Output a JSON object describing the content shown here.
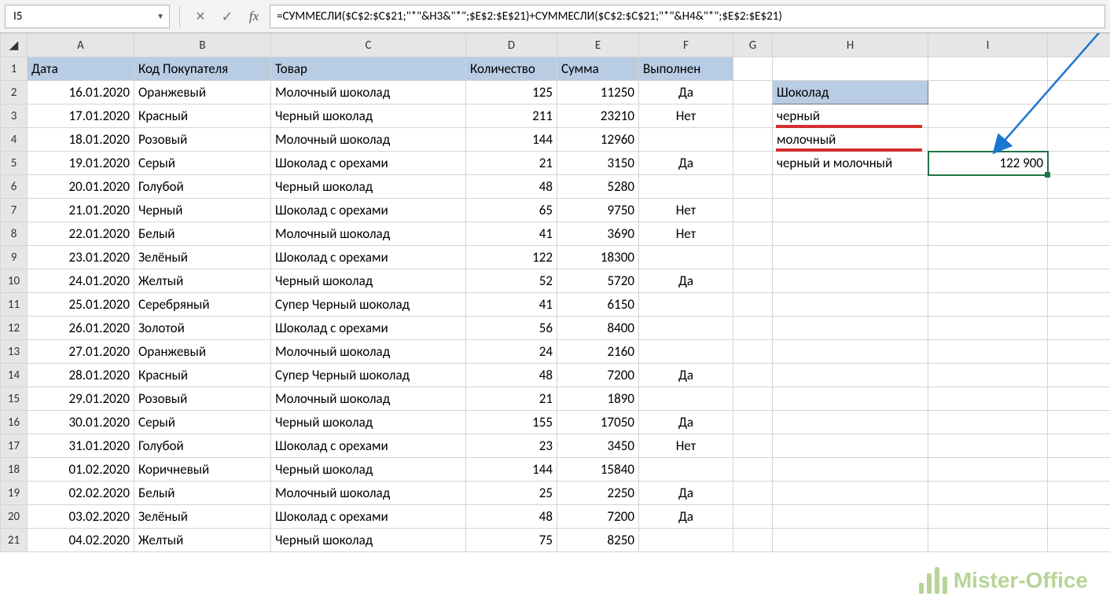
{
  "name_box": "I5",
  "formula": "=СУММЕСЛИ($C$2:$C$21;\"*\"&H3&\"*\";$E$2:$E$21)+СУММЕСЛИ($C$2:$C$21;\"*\"&H4&\"*\";$E$2:$E$21)",
  "fx_label": "fx",
  "columns": [
    "A",
    "B",
    "C",
    "D",
    "E",
    "F",
    "G",
    "H",
    "I"
  ],
  "headers": {
    "A": "Дата",
    "B": "Код Покупателя",
    "C": "Товар",
    "D": "Количество",
    "E": "Сумма",
    "F": "Выполнен"
  },
  "side": {
    "H2": "Шоколад",
    "H3": "черный",
    "H4": "молочный",
    "H5": "черный и молочный",
    "I5": "122 900"
  },
  "rows": [
    {
      "n": 1
    },
    {
      "n": 2,
      "A": "16.01.2020",
      "B": "Оранжевый",
      "C": "Молочный шоколад",
      "D": "125",
      "E": "11250",
      "F": "Да"
    },
    {
      "n": 3,
      "A": "17.01.2020",
      "B": "Красный",
      "C": "Черный шоколад",
      "D": "211",
      "E": "23210",
      "F": "Нет"
    },
    {
      "n": 4,
      "A": "18.01.2020",
      "B": "Розовый",
      "C": "Молочный шоколад",
      "D": "144",
      "E": "12960",
      "F": ""
    },
    {
      "n": 5,
      "A": "19.01.2020",
      "B": "Серый",
      "C": "Шоколад с орехами",
      "D": "21",
      "E": "3150",
      "F": "Да"
    },
    {
      "n": 6,
      "A": "20.01.2020",
      "B": "Голубой",
      "C": "Черный шоколад",
      "D": "48",
      "E": "5280",
      "F": ""
    },
    {
      "n": 7,
      "A": "21.01.2020",
      "B": "Черный",
      "C": "Шоколад с орехами",
      "D": "65",
      "E": "9750",
      "F": "Нет"
    },
    {
      "n": 8,
      "A": "22.01.2020",
      "B": "Белый",
      "C": "Молочный шоколад",
      "D": "41",
      "E": "3690",
      "F": "Нет"
    },
    {
      "n": 9,
      "A": "23.01.2020",
      "B": "Зелёный",
      "C": "Шоколад с орехами",
      "D": "122",
      "E": "18300",
      "F": ""
    },
    {
      "n": 10,
      "A": "24.01.2020",
      "B": "Желтый",
      "C": "Черный шоколад",
      "D": "52",
      "E": "5720",
      "F": "Да"
    },
    {
      "n": 11,
      "A": "25.01.2020",
      "B": "Серебряный",
      "C": "Супер Черный шоколад",
      "D": "41",
      "E": "6150",
      "F": ""
    },
    {
      "n": 12,
      "A": "26.01.2020",
      "B": "Золотой",
      "C": "Шоколад с орехами",
      "D": "56",
      "E": "8400",
      "F": ""
    },
    {
      "n": 13,
      "A": "27.01.2020",
      "B": "Оранжевый",
      "C": "Молочный шоколад",
      "D": "24",
      "E": "2160",
      "F": ""
    },
    {
      "n": 14,
      "A": "28.01.2020",
      "B": "Красный",
      "C": "Супер Черный шоколад",
      "D": "48",
      "E": "7200",
      "F": "Да"
    },
    {
      "n": 15,
      "A": "29.01.2020",
      "B": "Розовый",
      "C": "Молочный шоколад",
      "D": "21",
      "E": "1890",
      "F": ""
    },
    {
      "n": 16,
      "A": "30.01.2020",
      "B": "Серый",
      "C": "Черный шоколад",
      "D": "155",
      "E": "17050",
      "F": "Да"
    },
    {
      "n": 17,
      "A": "31.01.2020",
      "B": "Голубой",
      "C": "Шоколад с орехами",
      "D": "23",
      "E": "3450",
      "F": "Нет"
    },
    {
      "n": 18,
      "A": "01.02.2020",
      "B": "Коричневый",
      "C": "Черный шоколад",
      "D": "144",
      "E": "15840",
      "F": ""
    },
    {
      "n": 19,
      "A": "02.02.2020",
      "B": "Белый",
      "C": "Молочный шоколад",
      "D": "25",
      "E": "2250",
      "F": "Да"
    },
    {
      "n": 20,
      "A": "03.02.2020",
      "B": "Зелёный",
      "C": "Шоколад с орехами",
      "D": "48",
      "E": "7200",
      "F": "Да"
    },
    {
      "n": 21,
      "A": "04.02.2020",
      "B": "Желтый",
      "C": "Черный шоколад",
      "D": "75",
      "E": "8250",
      "F": ""
    }
  ],
  "watermark": "Mister-Office"
}
